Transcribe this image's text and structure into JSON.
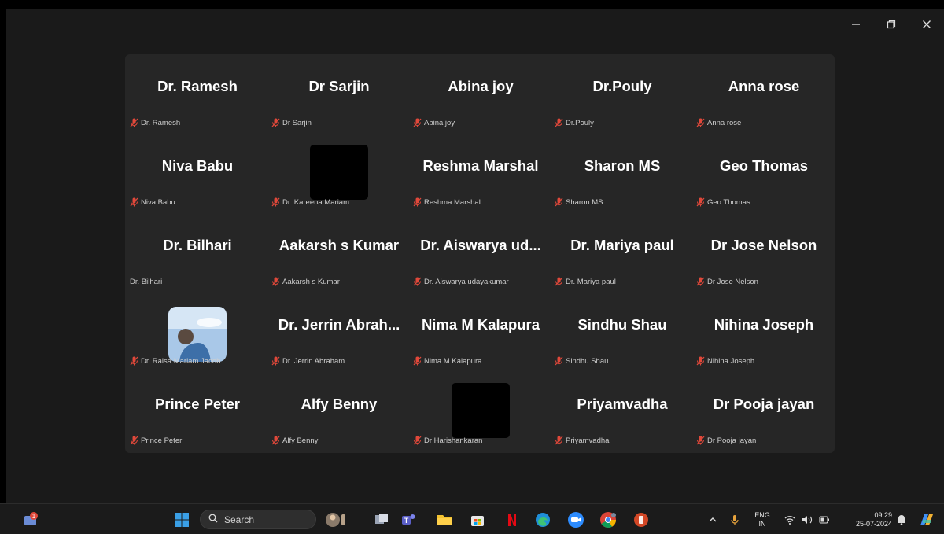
{
  "window": {
    "minimize_icon": "minimize-icon",
    "restore_icon": "restore-icon",
    "close_icon": "close-icon"
  },
  "participants": [
    {
      "name": "Dr. Ramesh",
      "label": "Dr. Ramesh",
      "muted": true,
      "video": "none"
    },
    {
      "name": "Dr Sarjin",
      "label": "Dr Sarjin",
      "muted": true,
      "video": "none"
    },
    {
      "name": "Abina joy",
      "label": "Abina joy",
      "muted": true,
      "video": "none"
    },
    {
      "name": "Dr.Pouly",
      "label": "Dr.Pouly",
      "muted": true,
      "video": "none"
    },
    {
      "name": "Anna rose",
      "label": "Anna rose",
      "muted": true,
      "video": "none"
    },
    {
      "name": "Niva Babu",
      "label": "Niva Babu",
      "muted": true,
      "video": "none"
    },
    {
      "name": "",
      "label": "Dr. Kareena Mariam",
      "muted": true,
      "video": "black"
    },
    {
      "name": "Reshma Marshal",
      "label": "Reshma Marshal",
      "muted": true,
      "video": "none"
    },
    {
      "name": "Sharon MS",
      "label": "Sharon MS",
      "muted": true,
      "video": "none"
    },
    {
      "name": "Geo Thomas",
      "label": "Geo Thomas",
      "muted": true,
      "video": "none"
    },
    {
      "name": "Dr. Bilhari",
      "label": "Dr. Bilhari",
      "muted": false,
      "video": "none"
    },
    {
      "name": "Aakarsh s Kumar",
      "label": "Aakarsh s Kumar",
      "muted": true,
      "video": "none"
    },
    {
      "name": "Dr. Aiswarya ud...",
      "label": "Dr. Aiswarya udayakumar",
      "muted": true,
      "video": "none"
    },
    {
      "name": "Dr. Mariya paul",
      "label": "Dr. Mariya paul",
      "muted": true,
      "video": "none"
    },
    {
      "name": "Dr Jose Nelson",
      "label": "Dr Jose Nelson",
      "muted": true,
      "video": "none"
    },
    {
      "name": "",
      "label": "Dr. Raisa Mariam Jacob",
      "muted": true,
      "video": "avatar"
    },
    {
      "name": "Dr. Jerrin Abrah...",
      "label": "Dr. Jerrin Abraham",
      "muted": true,
      "video": "none"
    },
    {
      "name": "Nima M Kalapura",
      "label": "Nima M Kalapura",
      "muted": true,
      "video": "none"
    },
    {
      "name": "Sindhu Shau",
      "label": "Sindhu Shau",
      "muted": true,
      "video": "none"
    },
    {
      "name": "Nihina Joseph",
      "label": "Nihina Joseph",
      "muted": true,
      "video": "none"
    },
    {
      "name": "Prince Peter",
      "label": "Prince Peter",
      "muted": true,
      "video": "none"
    },
    {
      "name": "Alfy Benny",
      "label": "Alfy Benny",
      "muted": true,
      "video": "none"
    },
    {
      "name": "",
      "label": "Dr Harishankaran",
      "muted": true,
      "video": "black"
    },
    {
      "name": "Priyamvadha",
      "label": "Priyamvadha",
      "muted": true,
      "video": "none"
    },
    {
      "name": "Dr Pooja jayan",
      "label": "Dr Pooja jayan",
      "muted": true,
      "video": "none"
    }
  ],
  "colors": {
    "muted_mic": "#e0483a",
    "gallery_bg": "#262626",
    "window_bg": "#1a1a1a"
  },
  "taskbar": {
    "search_placeholder": "Search",
    "apps": [
      "notification-app-icon",
      "windows-start-icon",
      "user-widget-icon",
      "task-view-icon",
      "teams-icon",
      "file-explorer-icon",
      "microsoft-store-icon",
      "netflix-icon",
      "edge-icon",
      "zoom-icon",
      "chrome-icon",
      "powerpoint-icon"
    ],
    "tray": {
      "language_top": "ENG",
      "language_bottom": "IN",
      "time": "09:29",
      "date": "25-07-2024"
    }
  }
}
